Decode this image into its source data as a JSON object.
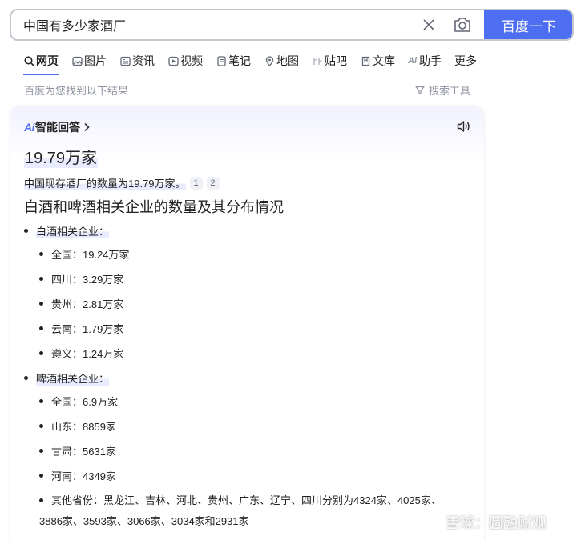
{
  "search": {
    "query": "中国有多少家酒厂",
    "button_label": "百度一下"
  },
  "tabs": [
    {
      "label": "网页",
      "icon": "search-icon",
      "active": true
    },
    {
      "label": "图片",
      "icon": "image-icon"
    },
    {
      "label": "资讯",
      "icon": "news-icon"
    },
    {
      "label": "视频",
      "icon": "video-icon"
    },
    {
      "label": "笔记",
      "icon": "note-icon"
    },
    {
      "label": "地图",
      "icon": "map-icon"
    },
    {
      "label": "贴吧",
      "icon": "tieba-icon"
    },
    {
      "label": "文库",
      "icon": "library-icon"
    },
    {
      "label": "助手",
      "icon": "ai-icon"
    },
    {
      "label": "更多",
      "icon": ""
    }
  ],
  "result_hint": "百度为您找到以下结果",
  "search_tools": "搜索工具",
  "ai": {
    "logo": "Ai",
    "title": "智能回答",
    "big_answer": "19.79万家",
    "summary": "中国现存酒厂的数量为19.79万家。",
    "citations": [
      "1",
      "2"
    ],
    "section_title": "白酒和啤酒相关企业的数量及其分布情况",
    "baijiu": {
      "heading": "白酒相关企业：",
      "items": [
        "全国：19.24万家",
        "四川：3.29万家",
        "贵州：2.81万家",
        "云南：1.79万家",
        "遵义：1.24万家"
      ]
    },
    "pijiu": {
      "heading": "啤酒相关企业：",
      "items": [
        "全国：6.9万家",
        "山东：8859家",
        "甘肃：5631家",
        "河南：4349家"
      ],
      "other": "其他省份：黑龙江、吉林、河北、贵州、广东、辽宁、四川分别为4324家、4025家、3886家、3593家、3066家、3034家和2931家"
    }
  },
  "watermark": "雪球：圆融财观",
  "colors": {
    "accent": "#4e6ef2",
    "muted": "#9195a3"
  }
}
